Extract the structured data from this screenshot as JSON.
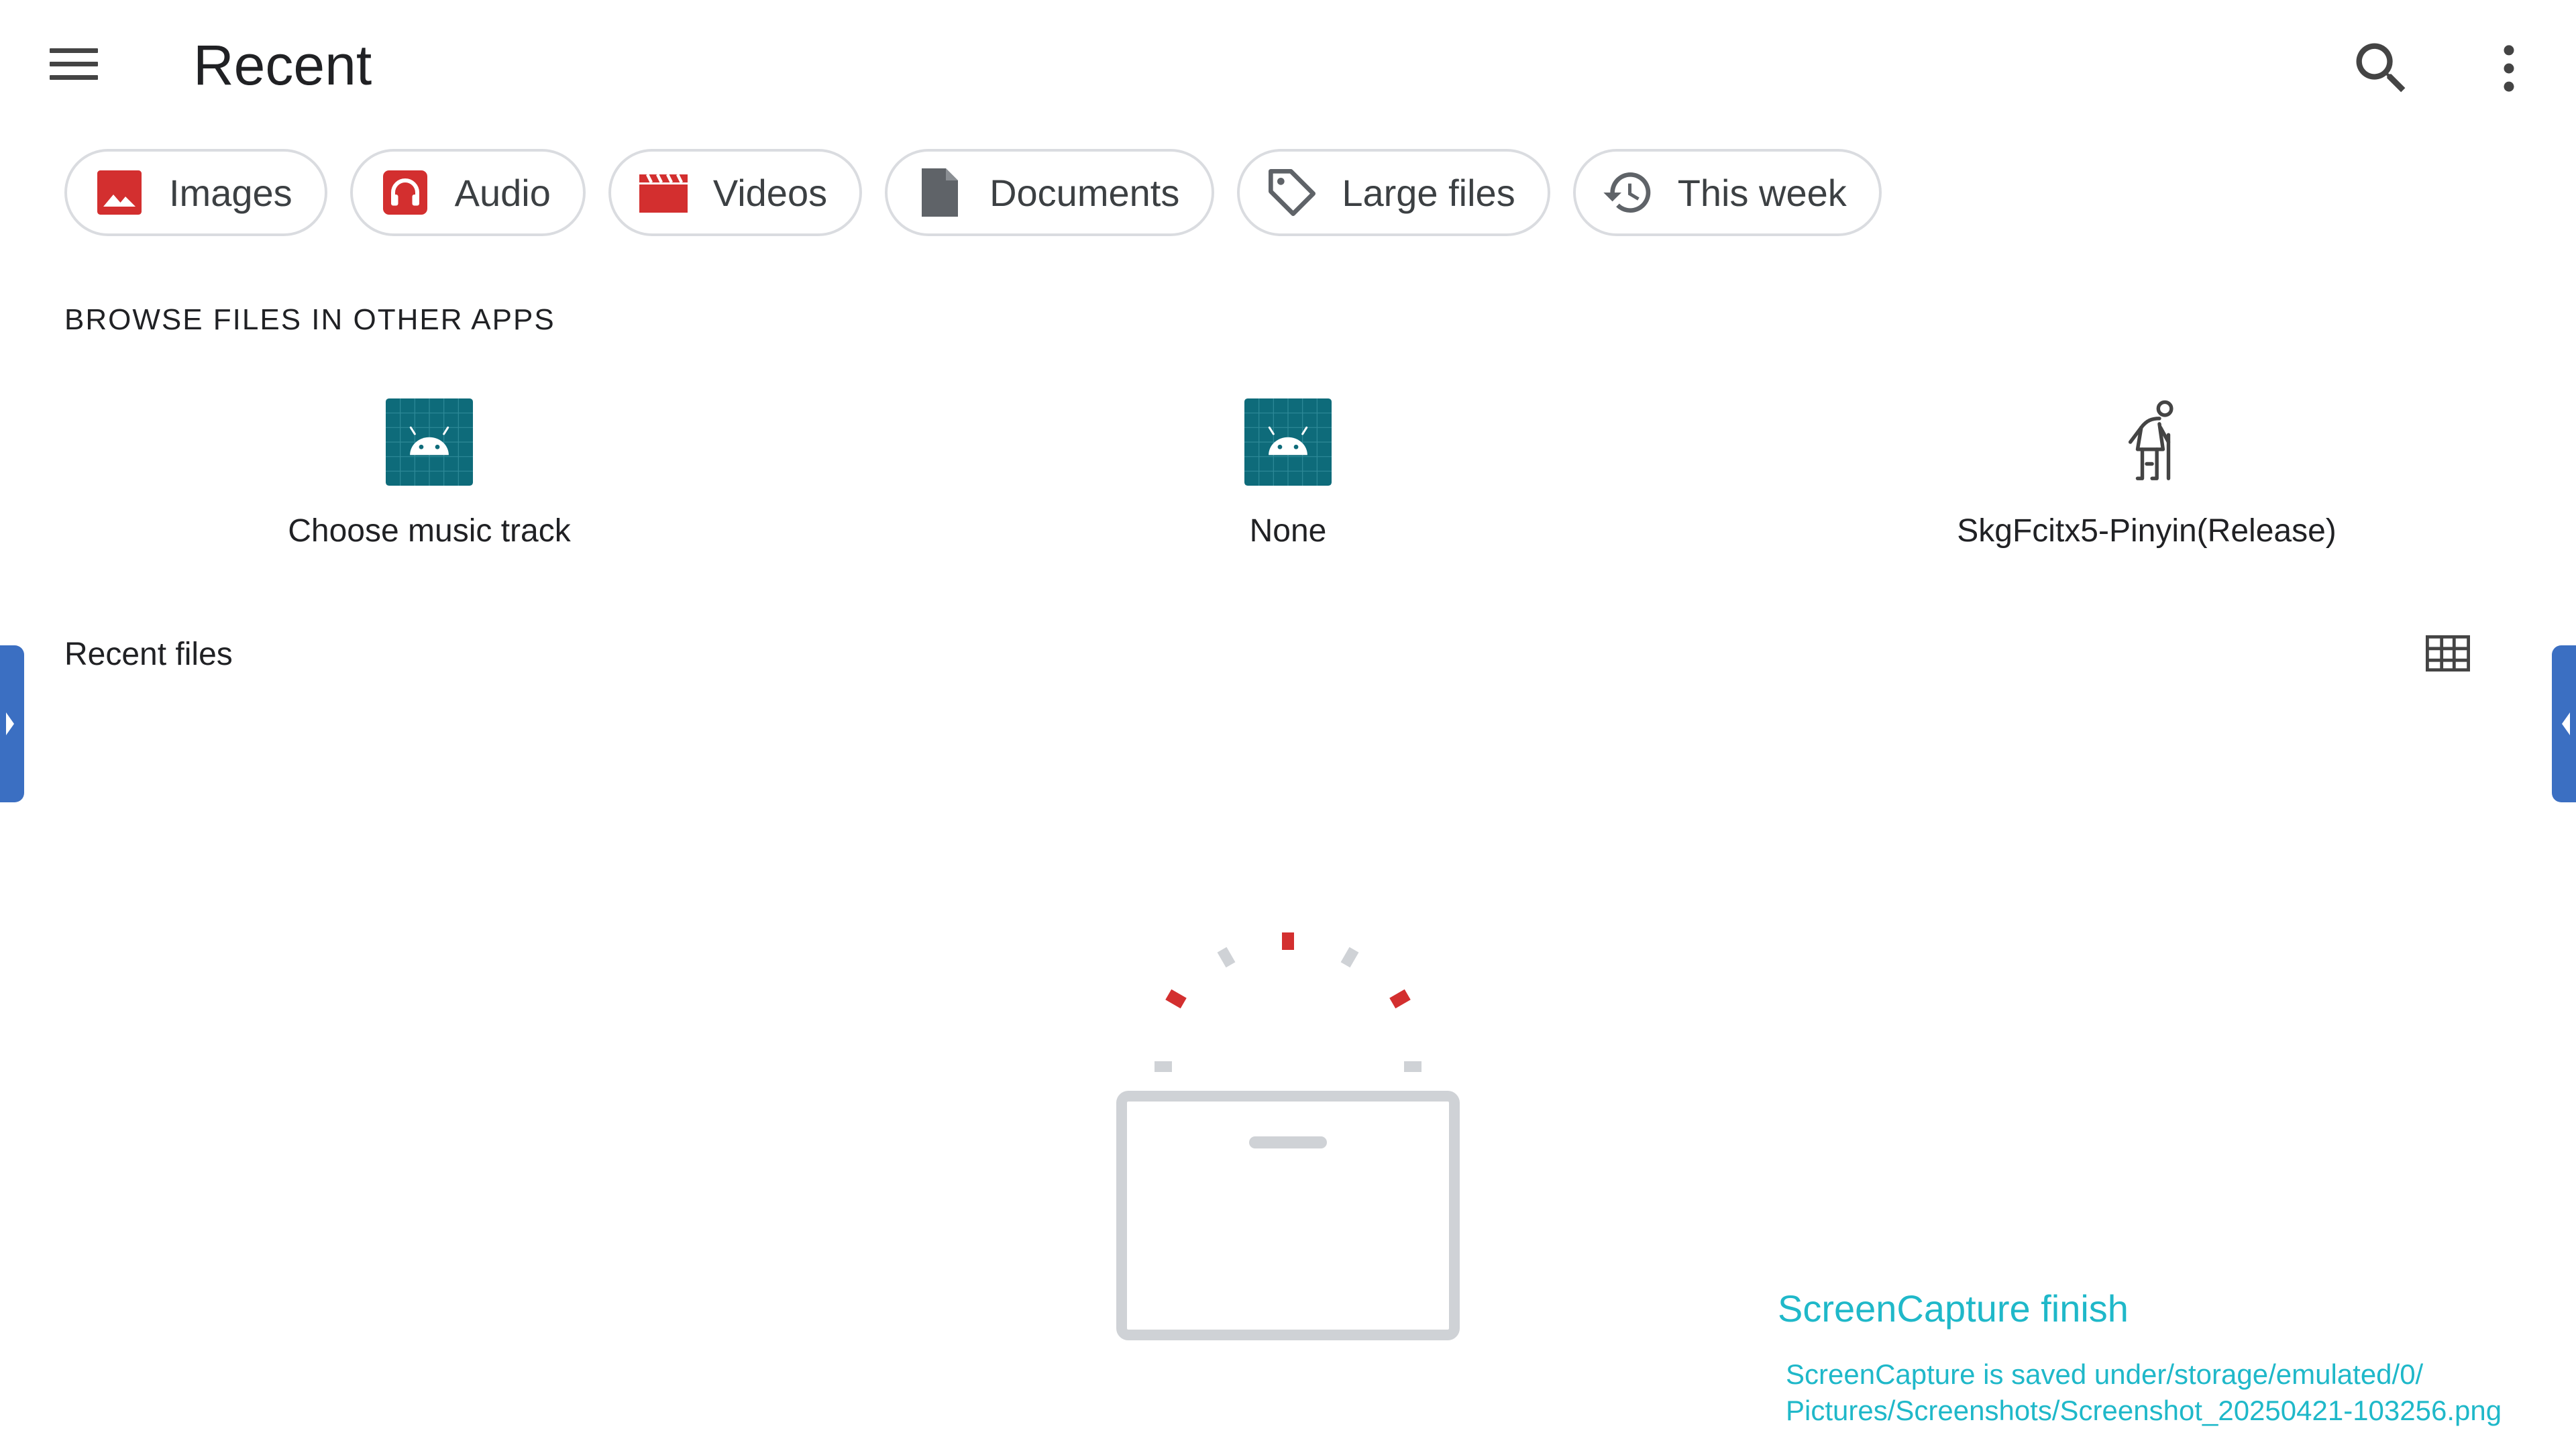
{
  "toolbar": {
    "title": "Recent",
    "menu_icon": "hamburger-menu-icon",
    "search_icon": "search-icon",
    "more_icon": "more-vert-icon"
  },
  "chips": [
    {
      "label": "Images",
      "icon": "image-icon",
      "color": "#d32f2f"
    },
    {
      "label": "Audio",
      "icon": "headphones-icon",
      "color": "#d32f2f"
    },
    {
      "label": "Videos",
      "icon": "clapperboard-icon",
      "color": "#d32f2f"
    },
    {
      "label": "Documents",
      "icon": "document-icon",
      "color": "#5f6368"
    },
    {
      "label": "Large files",
      "icon": "tag-icon",
      "color": "#5f6368"
    },
    {
      "label": "This week",
      "icon": "history-icon",
      "color": "#5f6368"
    }
  ],
  "browse_section": {
    "heading": "BROWSE FILES IN OTHER APPS",
    "apps": [
      {
        "label": "Choose music track",
        "icon": "android-app-icon"
      },
      {
        "label": "None",
        "icon": "android-app-icon"
      },
      {
        "label": "SkgFcitx5-Pinyin(Release)",
        "icon": "elderly-person-icon"
      }
    ]
  },
  "recent_files": {
    "heading": "Recent files",
    "view_icon": "grid-view-icon",
    "empty_illustration": "empty-tray-icon"
  },
  "toast": {
    "title": "ScreenCapture finish",
    "line1": "ScreenCapture is saved under/storage/emulated/0/",
    "line2": "Pictures/Screenshots/Screenshot_20250421-103256.png"
  },
  "colors": {
    "accent_red": "#d32f2f",
    "teal_icon": "#0e6b7a",
    "toast_text": "#1fb8c9",
    "side_handle": "#3b6fc2"
  }
}
